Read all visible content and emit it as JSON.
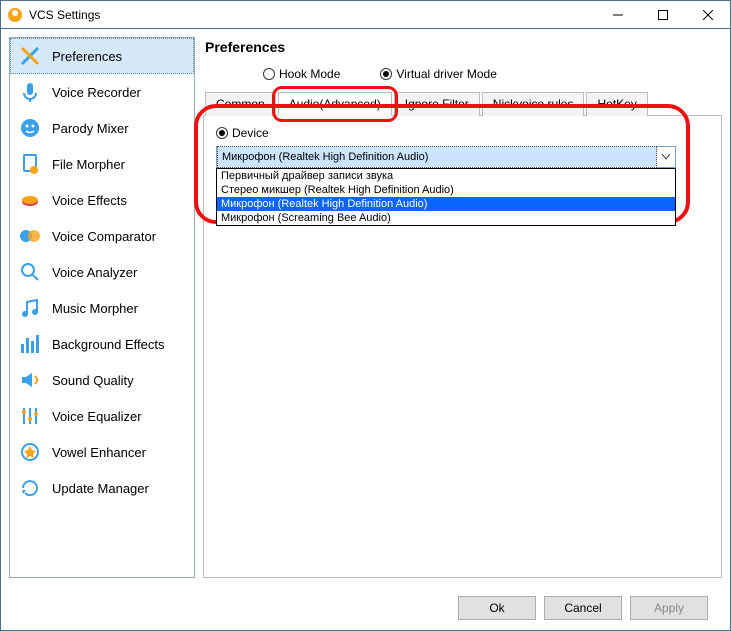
{
  "window": {
    "title": "VCS Settings"
  },
  "sidebar": {
    "items": [
      {
        "label": "Preferences",
        "icon": "tools-icon",
        "selected": true
      },
      {
        "label": "Voice Recorder",
        "icon": "mic-icon"
      },
      {
        "label": "Parody Mixer",
        "icon": "face-icon"
      },
      {
        "label": "File Morpher",
        "icon": "file-icon"
      },
      {
        "label": "Voice Effects",
        "icon": "mouth-icon"
      },
      {
        "label": "Voice Comparator",
        "icon": "compare-icon"
      },
      {
        "label": "Voice Analyzer",
        "icon": "analyze-icon"
      },
      {
        "label": "Music Morpher",
        "icon": "music-icon"
      },
      {
        "label": "Background Effects",
        "icon": "bars-icon"
      },
      {
        "label": "Sound Quality",
        "icon": "speaker-icon"
      },
      {
        "label": "Voice Equalizer",
        "icon": "eq-icon"
      },
      {
        "label": "Vowel Enhancer",
        "icon": "enhance-icon"
      },
      {
        "label": "Update Manager",
        "icon": "update-icon"
      }
    ]
  },
  "preferences": {
    "title": "Preferences",
    "modes": {
      "hook": "Hook Mode",
      "virtual": "Virtual driver Mode",
      "selected": "virtual"
    },
    "tabs": [
      {
        "label": "Common"
      },
      {
        "label": "Audio(Advanced)",
        "active": true
      },
      {
        "label": "Ignore Filter"
      },
      {
        "label": "Nickvoice rules"
      },
      {
        "label": "HotKey"
      }
    ],
    "device": {
      "radio_label": "Device",
      "selected": "Микрофон (Realtek High Definition Audio)",
      "options": [
        "Первичный драйвер записи звука",
        "Стерео микшер (Realtek High Definition Audio)",
        "Микрофон (Realtek High Definition Audio)",
        "Микрофон (Screaming Bee Audio)"
      ],
      "highlighted_index": 2
    }
  },
  "footer": {
    "ok": "Ok",
    "cancel": "Cancel",
    "apply": "Apply"
  },
  "icon_colors": {
    "accent_blue": "#3aa0e8",
    "accent_orange": "#f9a21a"
  }
}
